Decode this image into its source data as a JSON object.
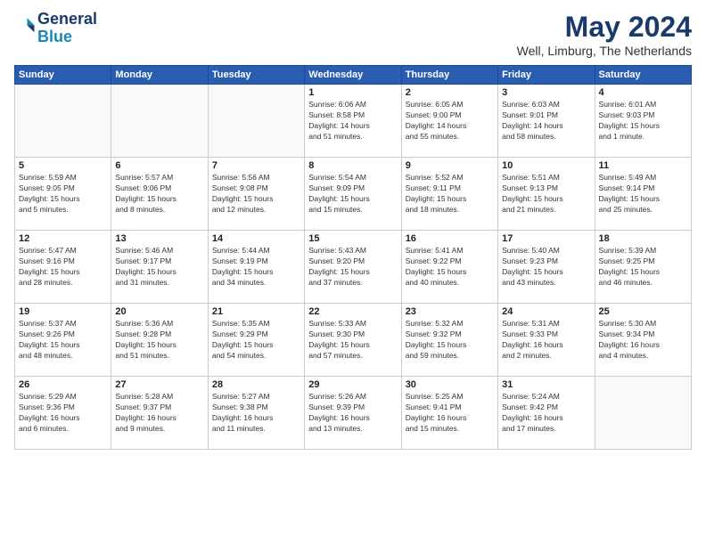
{
  "header": {
    "logo_line1": "General",
    "logo_line2": "Blue",
    "month_title": "May 2024",
    "location": "Well, Limburg, The Netherlands"
  },
  "days_of_week": [
    "Sunday",
    "Monday",
    "Tuesday",
    "Wednesday",
    "Thursday",
    "Friday",
    "Saturday"
  ],
  "weeks": [
    [
      {
        "day": "",
        "info": ""
      },
      {
        "day": "",
        "info": ""
      },
      {
        "day": "",
        "info": ""
      },
      {
        "day": "1",
        "info": "Sunrise: 6:06 AM\nSunset: 8:58 PM\nDaylight: 14 hours\nand 51 minutes."
      },
      {
        "day": "2",
        "info": "Sunrise: 6:05 AM\nSunset: 9:00 PM\nDaylight: 14 hours\nand 55 minutes."
      },
      {
        "day": "3",
        "info": "Sunrise: 6:03 AM\nSunset: 9:01 PM\nDaylight: 14 hours\nand 58 minutes."
      },
      {
        "day": "4",
        "info": "Sunrise: 6:01 AM\nSunset: 9:03 PM\nDaylight: 15 hours\nand 1 minute."
      }
    ],
    [
      {
        "day": "5",
        "info": "Sunrise: 5:59 AM\nSunset: 9:05 PM\nDaylight: 15 hours\nand 5 minutes."
      },
      {
        "day": "6",
        "info": "Sunrise: 5:57 AM\nSunset: 9:06 PM\nDaylight: 15 hours\nand 8 minutes."
      },
      {
        "day": "7",
        "info": "Sunrise: 5:56 AM\nSunset: 9:08 PM\nDaylight: 15 hours\nand 12 minutes."
      },
      {
        "day": "8",
        "info": "Sunrise: 5:54 AM\nSunset: 9:09 PM\nDaylight: 15 hours\nand 15 minutes."
      },
      {
        "day": "9",
        "info": "Sunrise: 5:52 AM\nSunset: 9:11 PM\nDaylight: 15 hours\nand 18 minutes."
      },
      {
        "day": "10",
        "info": "Sunrise: 5:51 AM\nSunset: 9:13 PM\nDaylight: 15 hours\nand 21 minutes."
      },
      {
        "day": "11",
        "info": "Sunrise: 5:49 AM\nSunset: 9:14 PM\nDaylight: 15 hours\nand 25 minutes."
      }
    ],
    [
      {
        "day": "12",
        "info": "Sunrise: 5:47 AM\nSunset: 9:16 PM\nDaylight: 15 hours\nand 28 minutes."
      },
      {
        "day": "13",
        "info": "Sunrise: 5:46 AM\nSunset: 9:17 PM\nDaylight: 15 hours\nand 31 minutes."
      },
      {
        "day": "14",
        "info": "Sunrise: 5:44 AM\nSunset: 9:19 PM\nDaylight: 15 hours\nand 34 minutes."
      },
      {
        "day": "15",
        "info": "Sunrise: 5:43 AM\nSunset: 9:20 PM\nDaylight: 15 hours\nand 37 minutes."
      },
      {
        "day": "16",
        "info": "Sunrise: 5:41 AM\nSunset: 9:22 PM\nDaylight: 15 hours\nand 40 minutes."
      },
      {
        "day": "17",
        "info": "Sunrise: 5:40 AM\nSunset: 9:23 PM\nDaylight: 15 hours\nand 43 minutes."
      },
      {
        "day": "18",
        "info": "Sunrise: 5:39 AM\nSunset: 9:25 PM\nDaylight: 15 hours\nand 46 minutes."
      }
    ],
    [
      {
        "day": "19",
        "info": "Sunrise: 5:37 AM\nSunset: 9:26 PM\nDaylight: 15 hours\nand 48 minutes."
      },
      {
        "day": "20",
        "info": "Sunrise: 5:36 AM\nSunset: 9:28 PM\nDaylight: 15 hours\nand 51 minutes."
      },
      {
        "day": "21",
        "info": "Sunrise: 5:35 AM\nSunset: 9:29 PM\nDaylight: 15 hours\nand 54 minutes."
      },
      {
        "day": "22",
        "info": "Sunrise: 5:33 AM\nSunset: 9:30 PM\nDaylight: 15 hours\nand 57 minutes."
      },
      {
        "day": "23",
        "info": "Sunrise: 5:32 AM\nSunset: 9:32 PM\nDaylight: 15 hours\nand 59 minutes."
      },
      {
        "day": "24",
        "info": "Sunrise: 5:31 AM\nSunset: 9:33 PM\nDaylight: 16 hours\nand 2 minutes."
      },
      {
        "day": "25",
        "info": "Sunrise: 5:30 AM\nSunset: 9:34 PM\nDaylight: 16 hours\nand 4 minutes."
      }
    ],
    [
      {
        "day": "26",
        "info": "Sunrise: 5:29 AM\nSunset: 9:36 PM\nDaylight: 16 hours\nand 6 minutes."
      },
      {
        "day": "27",
        "info": "Sunrise: 5:28 AM\nSunset: 9:37 PM\nDaylight: 16 hours\nand 9 minutes."
      },
      {
        "day": "28",
        "info": "Sunrise: 5:27 AM\nSunset: 9:38 PM\nDaylight: 16 hours\nand 11 minutes."
      },
      {
        "day": "29",
        "info": "Sunrise: 5:26 AM\nSunset: 9:39 PM\nDaylight: 16 hours\nand 13 minutes."
      },
      {
        "day": "30",
        "info": "Sunrise: 5:25 AM\nSunset: 9:41 PM\nDaylight: 16 hours\nand 15 minutes."
      },
      {
        "day": "31",
        "info": "Sunrise: 5:24 AM\nSunset: 9:42 PM\nDaylight: 16 hours\nand 17 minutes."
      },
      {
        "day": "",
        "info": ""
      }
    ]
  ]
}
